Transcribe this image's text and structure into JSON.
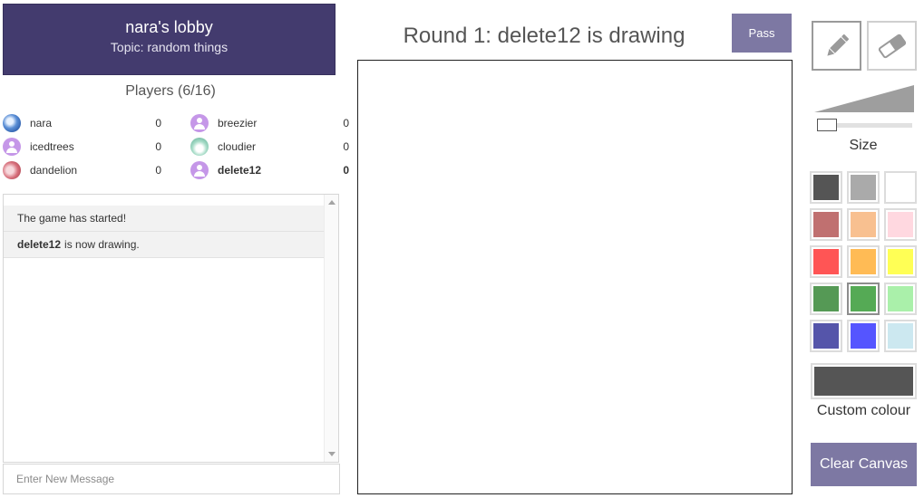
{
  "lobby": {
    "title": "nara's lobby",
    "topic": "Topic: random things"
  },
  "players_title": "Players (6/16)",
  "players": [
    {
      "name": "nara",
      "score": "0",
      "avatar": "nara-avatar",
      "current": false
    },
    {
      "name": "breezier",
      "score": "0",
      "avatar": "default-avatar",
      "current": false
    },
    {
      "name": "icedtrees",
      "score": "0",
      "avatar": "default-avatar",
      "current": false
    },
    {
      "name": "cloudier",
      "score": "0",
      "avatar": "cloudier-avatar",
      "current": false
    },
    {
      "name": "dandelion",
      "score": "0",
      "avatar": "dandelion-avatar",
      "current": false
    },
    {
      "name": "delete12",
      "score": "0",
      "avatar": "default-avatar",
      "current": true
    }
  ],
  "chat": {
    "messages": [
      {
        "bold": "",
        "text": "The game has started!"
      },
      {
        "bold": "delete12",
        "text": "is now drawing."
      }
    ],
    "input_placeholder": "Enter New Message"
  },
  "round_title": "Round 1: delete12 is drawing",
  "pass_label": "Pass",
  "tools": {
    "pencil": "pencil-icon",
    "eraser": "eraser-icon",
    "active": "pencil"
  },
  "size": {
    "label": "Size",
    "value_fraction": 0.0
  },
  "palette": {
    "colors": [
      "#555555",
      "#aaaaaa",
      "#ffffff",
      "#c07070",
      "#f8c090",
      "#ffd8e0",
      "#ff5555",
      "#ffbb55",
      "#ffff55",
      "#559955",
      "#55aa55",
      "#aaf0aa",
      "#5555aa",
      "#5555ff",
      "#cce8f0"
    ],
    "selected": "#55aa55"
  },
  "custom": {
    "label": "Custom colour",
    "color": "#555555"
  },
  "clear_label": "Clear Canvas",
  "theme": {
    "header_bg": "#433b6e",
    "button_bg": "#7d78a3",
    "default_avatar": "#c597e8"
  }
}
